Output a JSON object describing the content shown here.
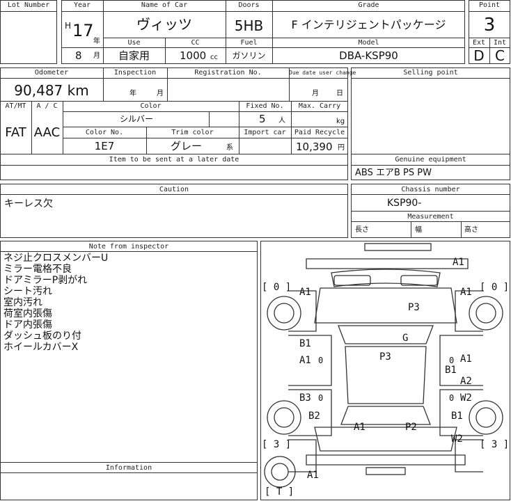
{
  "header": {
    "lot_number_label": "Lot Number",
    "year_label": "Year",
    "year_era": "H",
    "year_value": "17",
    "year_unit": "年",
    "month_value": "8",
    "month_unit": "月",
    "name_label": "Name of Car",
    "name_value": "ヴィッツ",
    "use_label": "Use",
    "use_value": "自家用",
    "cc_label": "CC",
    "cc_value": "1000",
    "cc_unit": "cc",
    "doors_label": "Doors",
    "doors_value": "5HB",
    "fuel_label": "Fuel",
    "fuel_value": "ガソリン",
    "grade_label": "Grade",
    "grade_value": "F インテリジェントパッケージ",
    "model_label": "Model",
    "model_value": "DBA-KSP90",
    "point_label": "Point",
    "point_value": "3",
    "ext_label": "Ext",
    "ext_value": "D",
    "int_label": "Int",
    "int_value": "C"
  },
  "details": {
    "odometer_label": "Odometer",
    "odometer_value": "90,487 km",
    "inspection_label": "Inspection",
    "inspection_year": "年",
    "inspection_month": "月",
    "registration_label": "Registration No.",
    "due_label": "Due date user change",
    "due_month": "月",
    "due_day": "日",
    "atmt_label": "AT/MT",
    "atmt_value": "FAT",
    "ac_label": "A / C",
    "ac_value": "AAC",
    "color_label": "Color",
    "color_value": "シルバー",
    "color_no_label": "Color No.",
    "color_no_value": "1E7",
    "trim_label": "Trim color",
    "trim_value": "グレー",
    "trim_suffix": "系",
    "fixed_label": "Fixed No.",
    "fixed_value": "5",
    "fixed_unit": "人",
    "carry_label": "Max. Carry",
    "carry_unit": "kg",
    "import_label": "Import car",
    "recycle_label": "Paid Recycle",
    "recycle_value": "10,390",
    "recycle_unit": "円",
    "later_label": "Item to be sent at a later date",
    "selling_label": "Selling point",
    "genuine_label": "Genuine equipment",
    "genuine_value": "ABS エアB PS PW"
  },
  "caution": {
    "label": "Caution",
    "value": "キーレス欠",
    "chassis_label": "Chassis number",
    "chassis_value": "KSP90-",
    "measure_label": "Measurement",
    "length_label": "長さ",
    "width_label": "幅",
    "height_label": "高さ"
  },
  "inspector": {
    "label": "Note from inspector",
    "lines": [
      "ネジ止クロスメンバーU",
      "ミラー電格不良",
      "ドアミラーP剥がれ",
      "シート汚れ",
      "室内汚れ",
      "荷室内張傷",
      "ドア内張傷",
      "ダッシュ板のり付",
      "ホイールカバーX"
    ],
    "information_label": "Information"
  },
  "diagram": {
    "codes": [
      "A1",
      "A1",
      "A1",
      "P3",
      "G",
      "P3",
      "B1",
      "A1",
      "B1",
      "A1",
      "A2",
      "B3",
      "W2",
      "B2",
      "B1",
      "A1",
      "P2",
      "W2",
      "A1"
    ],
    "zeros": [
      "0",
      "0",
      "0",
      "0"
    ],
    "tyres": [
      "[ 0 ]",
      "[ 0 ]",
      "[ 3 ]",
      "[ 3 ]",
      "[ T ]"
    ]
  }
}
